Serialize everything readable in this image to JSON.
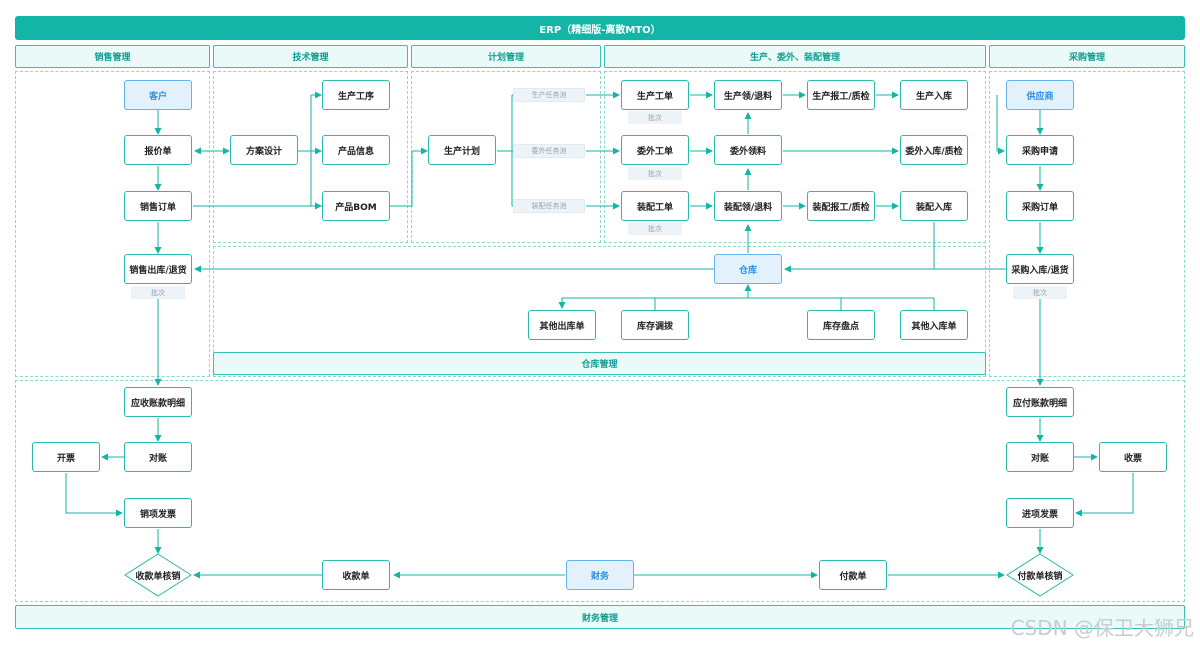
{
  "title": "ERP（精细版-离散MTO）",
  "sections": {
    "sales": "销售管理",
    "tech": "技术管理",
    "plan": "计划管理",
    "production": "生产、委外、装配管理",
    "purchase": "采购管理"
  },
  "warehouse_mgmt": "仓库管理",
  "finance_mgmt": "财务管理",
  "nodes": {
    "customer": "客户",
    "quote": "报价单",
    "sales_order": "销售订单",
    "sales_out": "销售出库/退货",
    "solution": "方案设计",
    "process": "生产工序",
    "product_info": "产品信息",
    "bom": "产品BOM",
    "prod_plan": "生产计划",
    "work_order": "生产工单",
    "outsource_order": "委外工单",
    "assembly_order": "装配工单",
    "prod_pick": "生产领/退料",
    "outsource_pick": "委外领料",
    "assembly_pick": "装配领/退料",
    "prod_report": "生产报工/质检",
    "assembly_report": "装配报工/质检",
    "prod_in": "生产入库",
    "outsource_in": "委外入库/质检",
    "assembly_in": "装配入库",
    "supplier": "供应商",
    "purchase_req": "采购申请",
    "purchase_order": "采购订单",
    "purchase_in": "采购入库/退货",
    "warehouse": "仓库",
    "other_out": "其他出库单",
    "transfer": "库存调拨",
    "stocktake": "库存盘点",
    "other_in": "其他入库单",
    "ar_detail": "应收账款明细",
    "invoice_issue": "开票",
    "reconcile_ar": "对账",
    "sales_invoice": "销项发票",
    "receipt_writeoff": "收款单核销",
    "receipt": "收款单",
    "finance": "财务",
    "payment": "付款单",
    "payment_writeoff": "付款单核销",
    "ap_detail": "应付账款明细",
    "reconcile_ap": "对账",
    "receive_invoice": "收票",
    "input_invoice": "进项发票"
  },
  "pools": {
    "prod_task_pool": "生产任务池",
    "outsource_task_pool": "委外任务池",
    "assembly_task_pool": "装配任务池"
  },
  "batch_label": "批次",
  "watermark": "CSDN @保卫大狮兄",
  "colors": {
    "accent": "#13b5a6",
    "border": "#2cb9ab",
    "highlight_fill": "#e3f1fd",
    "highlight_text": "#2d8fe0",
    "pool_fill": "#eef3f8"
  }
}
